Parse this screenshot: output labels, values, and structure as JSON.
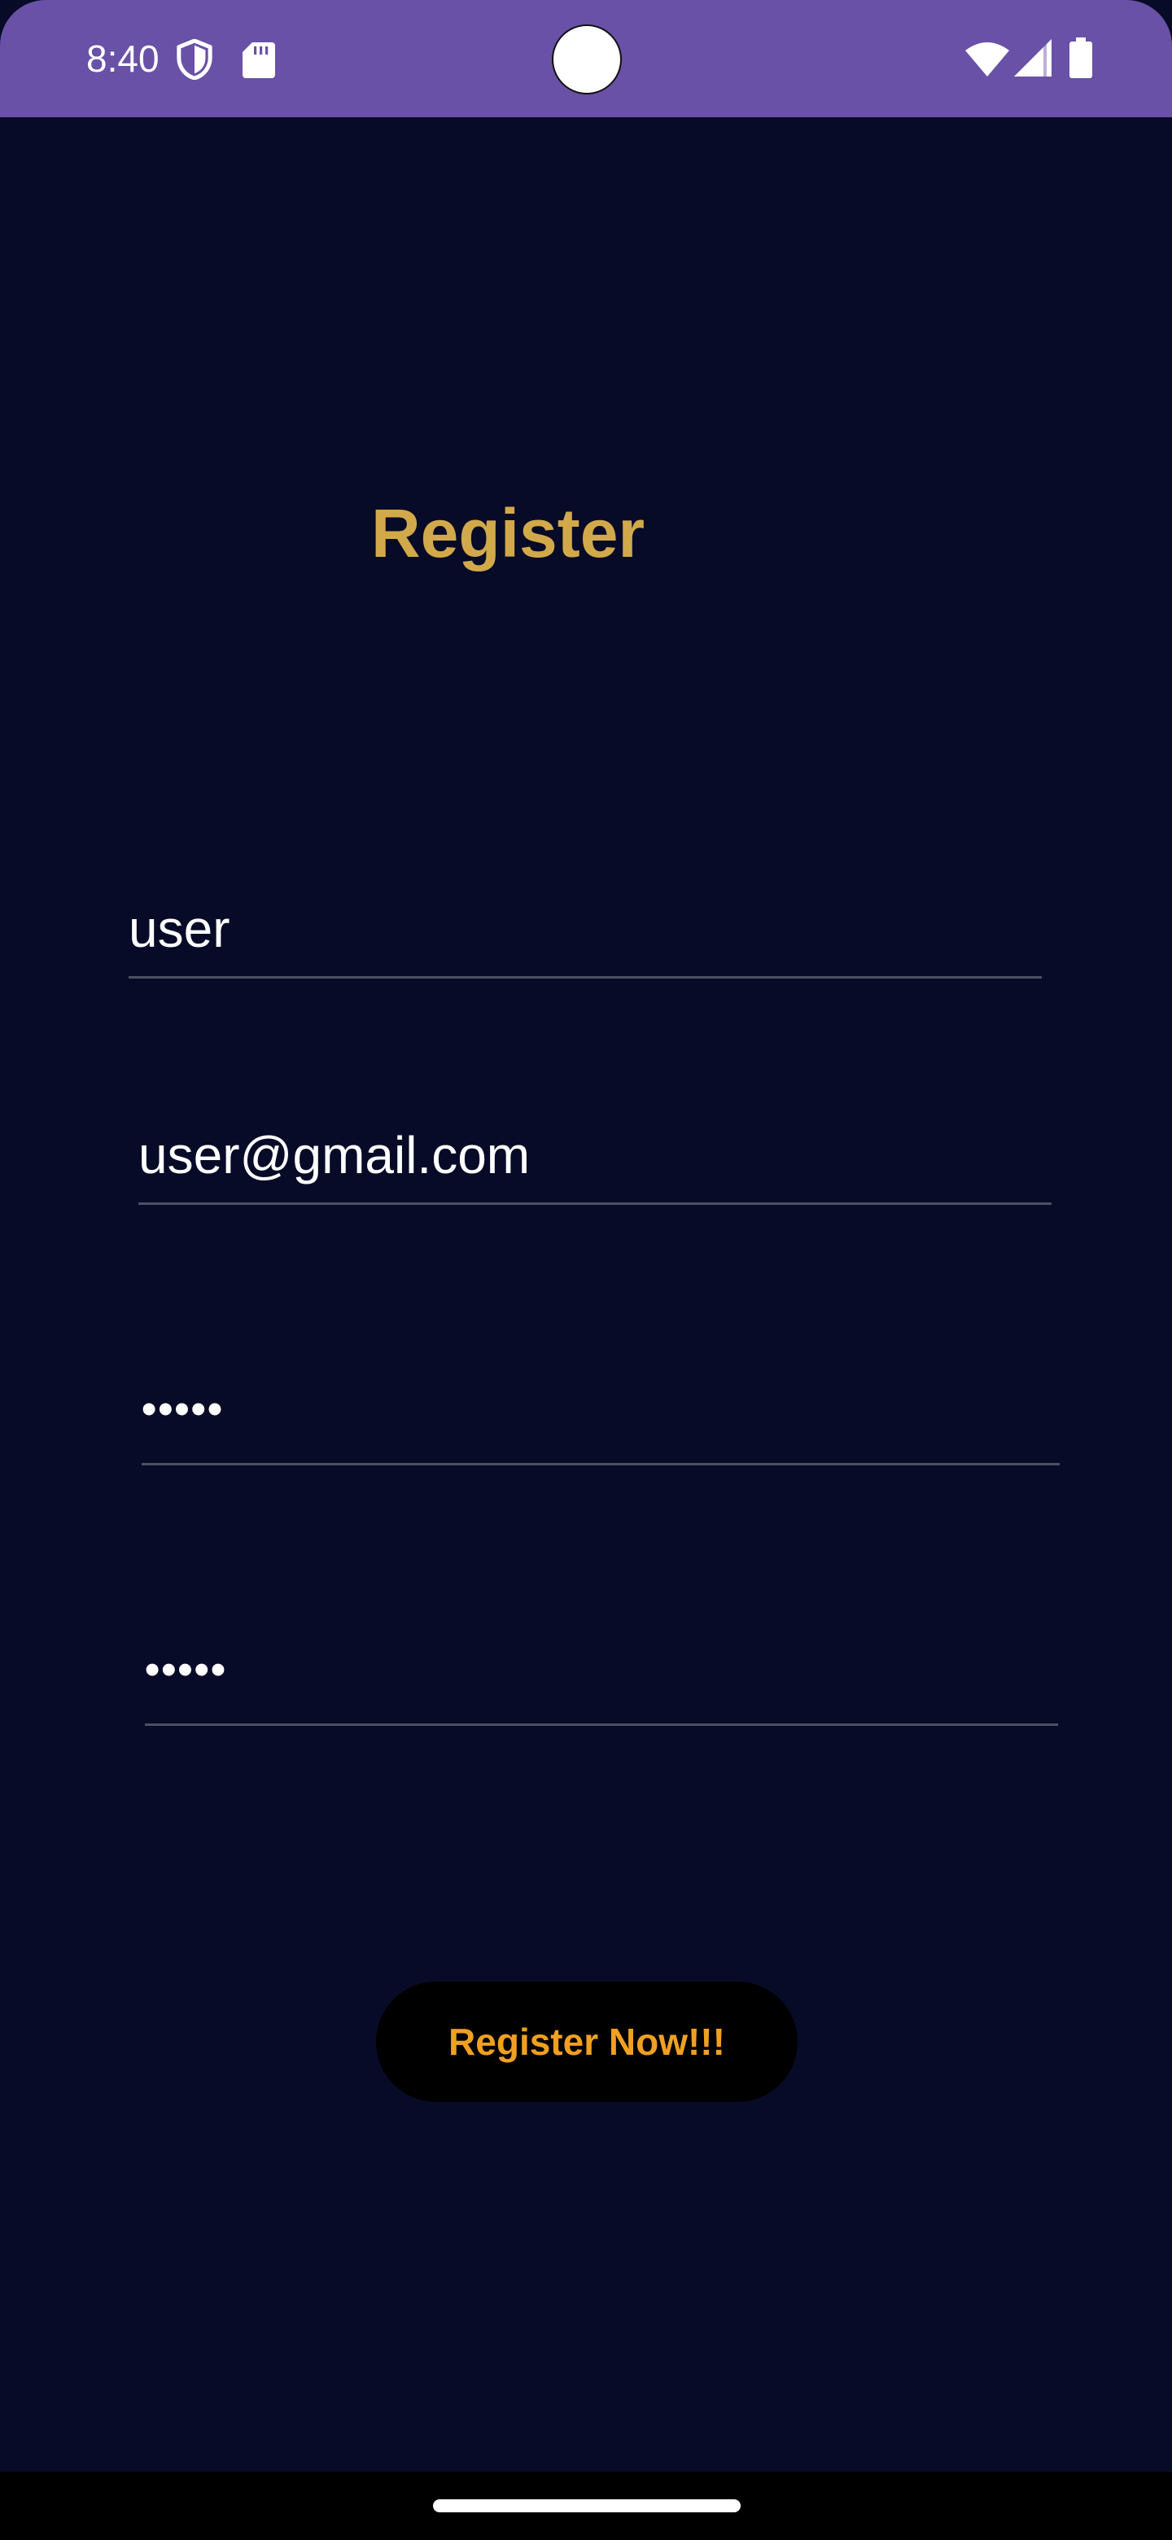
{
  "status_bar": {
    "time": "8:40",
    "background_color": "#6851a6",
    "icons": [
      "shield-icon",
      "sd-card-icon",
      "wifi-icon",
      "cell-signal-icon",
      "battery-icon"
    ]
  },
  "screen": {
    "background_color": "#070b27"
  },
  "register_form": {
    "title": "Register",
    "title_color": "#d2a94a",
    "username_value": "user",
    "email_value": "user@gmail.com",
    "password_value": "•••••",
    "confirm_password_value": "•••••",
    "submit_label": "Register Now!!!",
    "submit_text_color": "#f0a020"
  }
}
